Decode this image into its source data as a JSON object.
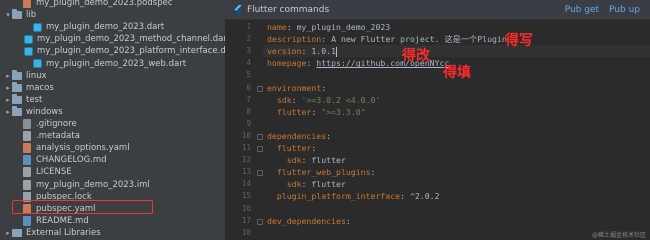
{
  "tree": {
    "items": [
      {
        "label": "my_plugin_demo_2023.podspec",
        "icon": "yaml-file-icon",
        "indent": 1,
        "chevron": ""
      },
      {
        "label": "lib",
        "icon": "folder-icon",
        "indent": 0,
        "chevron": "▾"
      },
      {
        "label": "my_plugin_demo_2023.dart",
        "icon": "dart-file-icon",
        "indent": 2,
        "chevron": ""
      },
      {
        "label": "my_plugin_demo_2023_method_channel.dart",
        "icon": "dart-file-icon",
        "indent": 2,
        "chevron": ""
      },
      {
        "label": "my_plugin_demo_2023_platform_interface.dart",
        "icon": "dart-file-icon",
        "indent": 2,
        "chevron": ""
      },
      {
        "label": "my_plugin_demo_2023_web.dart",
        "icon": "dart-file-icon",
        "indent": 2,
        "chevron": ""
      },
      {
        "label": "linux",
        "icon": "folder-icon",
        "indent": 0,
        "chevron": "▸"
      },
      {
        "label": "macos",
        "icon": "folder-icon",
        "indent": 0,
        "chevron": "▸"
      },
      {
        "label": "test",
        "icon": "folder-icon",
        "indent": 0,
        "chevron": "▸"
      },
      {
        "label": "windows",
        "icon": "folder-icon",
        "indent": 0,
        "chevron": "▸"
      },
      {
        "label": ".gitignore",
        "icon": "gitignore-file-icon",
        "indent": 1,
        "chevron": ""
      },
      {
        "label": ".metadata",
        "icon": "file-icon",
        "indent": 1,
        "chevron": ""
      },
      {
        "label": "analysis_options.yaml",
        "icon": "yaml-file-icon",
        "indent": 1,
        "chevron": ""
      },
      {
        "label": "CHANGELOG.md",
        "icon": "markdown-file-icon",
        "indent": 1,
        "chevron": ""
      },
      {
        "label": "LICENSE",
        "icon": "file-icon",
        "indent": 1,
        "chevron": ""
      },
      {
        "label": "my_plugin_demo_2023.iml",
        "icon": "file-icon",
        "indent": 1,
        "chevron": ""
      },
      {
        "label": "pubspec.lock",
        "icon": "file-icon",
        "indent": 1,
        "chevron": ""
      },
      {
        "label": "pubspec.yaml",
        "icon": "yaml-file-icon",
        "indent": 1,
        "chevron": ""
      },
      {
        "label": "README.md",
        "icon": "markdown-file-icon",
        "indent": 1,
        "chevron": ""
      },
      {
        "label": "External Libraries",
        "icon": "external-libraries-icon",
        "indent": 0,
        "chevron": "▸"
      }
    ]
  },
  "banner": {
    "title": "Flutter commands",
    "pub_get": "Pub get",
    "pub_upgrade": "Pub up"
  },
  "editor": {
    "line_numbers": [
      "1",
      "2",
      "3",
      "4",
      "5",
      "6",
      "7",
      "8",
      "9",
      "10",
      "11",
      "12",
      "13",
      "14",
      "15",
      "16",
      "17",
      "18"
    ],
    "lines": [
      [
        {
          "t": "name",
          "c": "k"
        },
        {
          "t": ": my_plugin_demo_2023",
          "c": "plain"
        }
      ],
      [
        {
          "t": "description",
          "c": "k"
        },
        {
          "t": ": A new Flutter project. 这是一个Plugin",
          "c": "plain"
        }
      ],
      [
        {
          "t": "version",
          "c": "k"
        },
        {
          "t": ": 1.0.1",
          "c": "plain"
        }
      ],
      [
        {
          "t": "homepage",
          "c": "k"
        },
        {
          "t": ": ",
          "c": "plain"
        },
        {
          "t": "https://github.com/openNYcc",
          "c": "url"
        }
      ],
      [],
      [
        {
          "t": "environment",
          "c": "k"
        },
        {
          "t": ":",
          "c": "plain"
        }
      ],
      [
        {
          "t": "  sdk",
          "c": "k"
        },
        {
          "t": ": ",
          "c": "plain"
        },
        {
          "t": "'>=3.0.2 <4.0.0'",
          "c": "s"
        }
      ],
      [
        {
          "t": "  flutter",
          "c": "k"
        },
        {
          "t": ": ",
          "c": "plain"
        },
        {
          "t": "\">=3.3.0\"",
          "c": "s"
        }
      ],
      [],
      [
        {
          "t": "dependencies",
          "c": "k"
        },
        {
          "t": ":",
          "c": "plain"
        }
      ],
      [
        {
          "t": "  flutter",
          "c": "k"
        },
        {
          "t": ":",
          "c": "plain"
        }
      ],
      [
        {
          "t": "    sdk",
          "c": "k"
        },
        {
          "t": ": flutter",
          "c": "plain"
        }
      ],
      [
        {
          "t": "  flutter_web_plugins",
          "c": "k"
        },
        {
          "t": ":",
          "c": "plain"
        }
      ],
      [
        {
          "t": "    sdk",
          "c": "k"
        },
        {
          "t": ": flutter",
          "c": "plain"
        }
      ],
      [
        {
          "t": "  plugin_platform_interface",
          "c": "k"
        },
        {
          "t": ": ^2.0.2",
          "c": "plain"
        }
      ],
      [],
      [
        {
          "t": "dev_dependencies",
          "c": "k"
        },
        {
          "t": ":",
          "c": "plain"
        }
      ]
    ]
  },
  "annotations": {
    "must_write": "得写",
    "must_change": "得改",
    "must_fill": "得填"
  },
  "watermark": "@稀土掘金技术社区",
  "colors": {
    "keyword": "#cc7832",
    "string": "#6a8759",
    "annotation": "#ff2a2a",
    "highlight_box": "#e53935"
  }
}
